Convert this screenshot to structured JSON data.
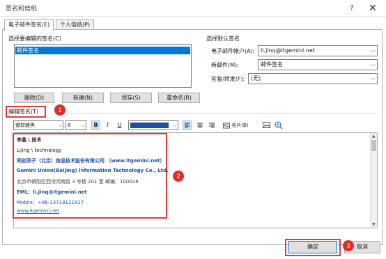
{
  "window": {
    "title": "签名和信纸",
    "help": "?",
    "close": "✕"
  },
  "tabs": [
    {
      "label": "电子邮件签名(E)",
      "active": true
    },
    {
      "label": "个人信纸(P)",
      "active": false
    }
  ],
  "select_section": {
    "label": "选择要编辑的签名(C)",
    "items": [
      "邮件签名"
    ],
    "buttons": {
      "delete": "删除(D)",
      "new": "新建(N)",
      "save": "保存(S)",
      "rename": "重命名(R)"
    }
  },
  "default_section": {
    "label": "选择默认签名",
    "account_label": "电子邮件帐户(A):",
    "account_value": "li.jinq@itgemini.net",
    "new_msg_label": "新邮件(M):",
    "new_msg_value": "邮件签名",
    "reply_label": "答复/转发(F):",
    "reply_value": "(无)"
  },
  "edit_section": {
    "label": "编辑签名(T)"
  },
  "toolbar": {
    "font": "微软雅黑",
    "size": "8",
    "bold": "B",
    "italic": "I",
    "underline": "U",
    "font_color": "#1f4e9c",
    "business_card": "名片(B)"
  },
  "signature": {
    "name_line": "李晶 \\ 技术",
    "name_en": "Lijing \\ technology",
    "company_cn": "同创双子（北京）信息技术股份有限公司 （www.itgemini.net）",
    "company_en": "Gemini Union(Beijing) Information Technology Co., Ltd.",
    "address": "北京市朝阳区西坝河南路 3 号楼 201 室 邮编：100028",
    "eml": "EML：li.jinq@itgemini.net",
    "mobile": "Mobile：+86-13718121817",
    "website": "www.itgemini.net"
  },
  "callouts": {
    "one": "1",
    "two": "2",
    "three": "3"
  },
  "footer": {
    "ok": "确定",
    "cancel": "取消"
  },
  "colors": {
    "accent": "#0078d7",
    "annotation": "#e03c3c"
  }
}
